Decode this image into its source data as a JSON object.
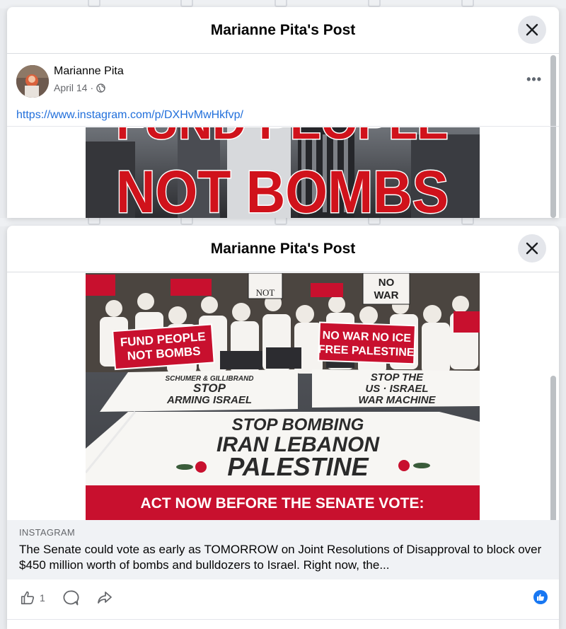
{
  "top_post": {
    "title": "Marianne Pita's Post",
    "author": "Marianne Pita",
    "date": "April 14",
    "separator": "·",
    "link": "https://www.instagram.com/p/DXHvMwHkfvp/",
    "hero_line1": "FUND PEOPLE",
    "hero_line2": "NOT BOMBS"
  },
  "bottom_post": {
    "title": "Marianne Pita's Post",
    "photo": {
      "banner_left_1": "FUND PEOPLE",
      "banner_left_2": "NOT BOMBS",
      "banner_right_1": "NO WAR NO ICE",
      "banner_right_2": "FREE PALESTINE",
      "ground_left_1": "SCHUMER & GILLIBRAND",
      "ground_left_2": "STOP",
      "ground_left_3": "ARMING ISRAEL",
      "ground_right_1": "STOP THE",
      "ground_right_2": "US · ISRAEL",
      "ground_right_3": "WAR MACHINE",
      "main_line1": "STOP BOMBING",
      "main_line2": "IRAN LEBANON",
      "main_line3": "PALESTINE",
      "sign_top_1": "NO",
      "sign_top_2": "WAR",
      "sign_top_3": "NOT",
      "red_bar": "ACT NOW BEFORE THE SENATE VOTE:"
    },
    "preview": {
      "source": "INSTAGRAM",
      "text": "The Senate could vote as early as TOMORROW on Joint Resolutions of Disapproval to block over $450 million worth of bombs and bulldozers to Israel. Right now, the..."
    },
    "actions": {
      "like_count": "1"
    }
  },
  "colors": {
    "brand_blue": "#1877f2",
    "link_blue": "#216fdb",
    "protest_red": "#c8102e"
  }
}
